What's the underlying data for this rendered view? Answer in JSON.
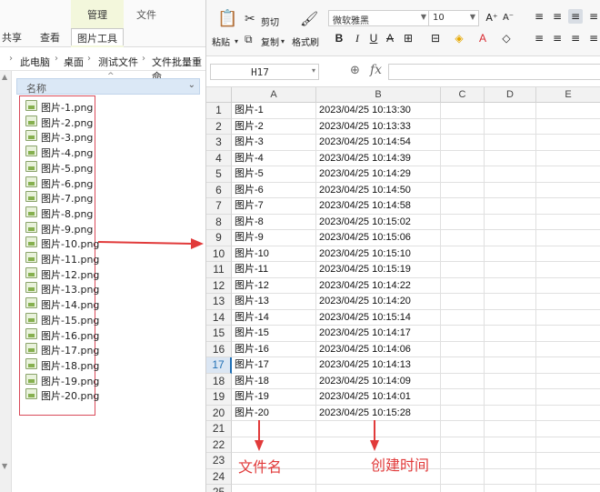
{
  "explorer": {
    "ribbon": {
      "context_title": "管理",
      "file_tab": "文件",
      "tabs": [
        "共享",
        "查看"
      ],
      "active_tab": "图片工具"
    },
    "breadcrumb": [
      "此电脑",
      "桌面",
      "测试文件",
      "文件批量重命"
    ],
    "column_header": "名称",
    "files": [
      "图片-1.png",
      "图片-2.png",
      "图片-3.png",
      "图片-4.png",
      "图片-5.png",
      "图片-6.png",
      "图片-7.png",
      "图片-8.png",
      "图片-9.png",
      "图片-10.png",
      "图片-11.png",
      "图片-12.png",
      "图片-13.png",
      "图片-14.png",
      "图片-15.png",
      "图片-16.png",
      "图片-17.png",
      "图片-18.png",
      "图片-19.png",
      "图片-20.png"
    ]
  },
  "spreadsheet": {
    "toolbar": {
      "paste_label": "粘贴",
      "cut_label": "剪切",
      "copy_label": "复制",
      "format_painter_label": "格式刷",
      "font_name": "微软雅黑",
      "font_size": "10"
    },
    "name_box": "H17",
    "fx_label": "fx",
    "columns": [
      "A",
      "B",
      "C",
      "D",
      "E"
    ],
    "rows": [
      "1",
      "2",
      "3",
      "4",
      "5",
      "6",
      "7",
      "8",
      "9",
      "10",
      "11",
      "12",
      "13",
      "14",
      "15",
      "16",
      "17",
      "18",
      "19",
      "20",
      "21",
      "22",
      "23",
      "24",
      "25"
    ],
    "selected_row": "17",
    "names": [
      "图片-1",
      "图片-2",
      "图片-3",
      "图片-4",
      "图片-5",
      "图片-6",
      "图片-7",
      "图片-8",
      "图片-9",
      "图片-10",
      "图片-11",
      "图片-12",
      "图片-13",
      "图片-14",
      "图片-15",
      "图片-16",
      "图片-17",
      "图片-18",
      "图片-19",
      "图片-20"
    ],
    "times": [
      "2023/04/25 10:13:30",
      "2023/04/25 10:13:33",
      "2023/04/25 10:14:54",
      "2023/04/25 10:14:39",
      "2023/04/25 10:14:29",
      "2023/04/25 10:14:50",
      "2023/04/25 10:14:58",
      "2023/04/25 10:15:02",
      "2023/04/25 10:15:06",
      "2023/04/25 10:15:10",
      "2023/04/25 10:15:19",
      "2023/04/25 10:14:22",
      "2023/04/25 10:14:20",
      "2023/04/25 10:15:14",
      "2023/04/25 10:14:17",
      "2023/04/25 10:14:06",
      "2023/04/25 10:14:13",
      "2023/04/25 10:14:09",
      "2023/04/25 10:14:01",
      "2023/04/25 10:15:28"
    ]
  },
  "annotations": {
    "filename_label": "文件名",
    "created_time_label": "创建时间",
    "color": "#e13a3a"
  }
}
